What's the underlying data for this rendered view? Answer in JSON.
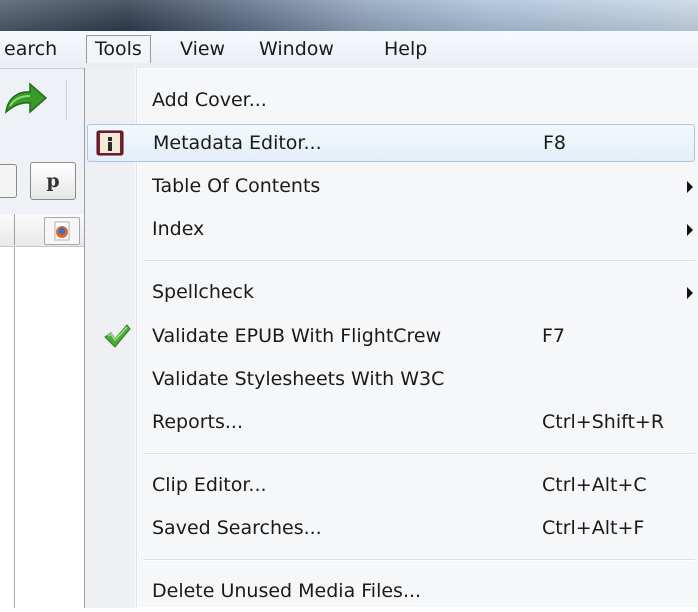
{
  "menubar": {
    "search_label": "earch",
    "tools_label": "Tools",
    "view_label": "View",
    "window_label": "Window",
    "help_label": "Help"
  },
  "left_panel": {
    "format_button_label": "p"
  },
  "tools_menu": {
    "items": [
      {
        "label": "Add Cover...",
        "shortcut": ""
      },
      {
        "label": "Metadata Editor...",
        "shortcut": "F8",
        "icon": "metadata-editor-icon"
      },
      {
        "label": "Table Of Contents",
        "shortcut": "",
        "submenu": true
      },
      {
        "label": "Index",
        "shortcut": "",
        "submenu": true
      },
      {
        "label": "Spellcheck",
        "shortcut": "",
        "submenu": true
      },
      {
        "label": "Validate EPUB With FlightCrew",
        "shortcut": "F7",
        "icon": "checkmark-icon"
      },
      {
        "label": "Validate Stylesheets With W3C",
        "shortcut": ""
      },
      {
        "label": "Reports...",
        "shortcut": "Ctrl+Shift+R"
      },
      {
        "label": "Clip Editor...",
        "shortcut": "Ctrl+Alt+C"
      },
      {
        "label": "Saved Searches...",
        "shortcut": "Ctrl+Alt+F"
      },
      {
        "label": "Delete Unused Media Files...",
        "shortcut": ""
      }
    ]
  },
  "colors": {
    "highlight_bg": "#e4eef9",
    "highlight_border": "#a9c6e6",
    "menu_bg": "#f6f7f9",
    "check_green": "#4cab3b",
    "redo_green": "#3a9b2a"
  }
}
